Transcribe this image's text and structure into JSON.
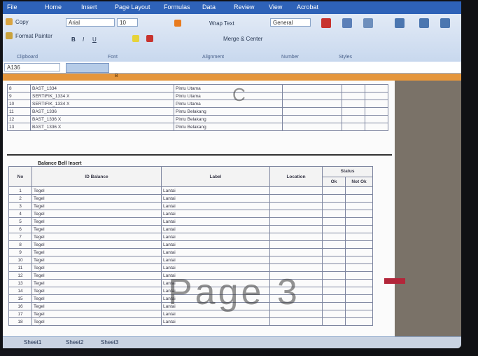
{
  "menu": {
    "tabs": [
      "File",
      "Home",
      "Insert",
      "Page Layout",
      "Formulas",
      "Data",
      "Review",
      "View",
      "Acrobat"
    ]
  },
  "ribbon": {
    "clipboard_copy": "Copy",
    "format_painter": "Format Painter",
    "clipboard_label": "Clipboard",
    "font_name": "Arial",
    "font_size": "10",
    "font_label": "Font",
    "wrap_text": "Wrap Text",
    "merge_center": "Merge & Center",
    "alignment_label": "Alignment",
    "number_format": "General",
    "number_label": "Number",
    "styles_label": "Styles"
  },
  "formula_bar": {
    "name_box": "A136"
  },
  "sheet": {
    "column_letter": "B",
    "top_rows": [
      {
        "num": "8",
        "name": "BAST_1334",
        "type": "Pintu Utama",
        "code": "",
        "a": "",
        "b": ""
      },
      {
        "num": "9",
        "name": "SERTIFIK_1334 X",
        "type": "Pintu Utama",
        "code": "",
        "a": "",
        "b": ""
      },
      {
        "num": "10",
        "name": "SERTIFIK_1334 X",
        "type": "Pintu Utama",
        "code": "",
        "a": "",
        "b": ""
      },
      {
        "num": "11",
        "name": "BAST_1336",
        "type": "Pintu Belakang",
        "code": "",
        "a": "",
        "b": ""
      },
      {
        "num": "12",
        "name": "BAST_1336 X",
        "type": "Pintu Belakang",
        "code": "",
        "a": "",
        "b": ""
      },
      {
        "num": "13",
        "name": "BAST_1336 X",
        "type": "Pintu Belakang",
        "code": "",
        "a": "",
        "b": ""
      }
    ],
    "section_title": "Balance Bell Insert",
    "headers": {
      "no": "No",
      "id": "ID Balance",
      "label": "Label",
      "location": "Location",
      "group": "Status",
      "sub1": "Ok",
      "sub2": "Not Ok"
    },
    "rows": [
      {
        "num": "1",
        "id": "Tegel",
        "label": "Lantai",
        "loc": ""
      },
      {
        "num": "2",
        "id": "Tegel",
        "label": "Lantai",
        "loc": ""
      },
      {
        "num": "3",
        "id": "Tegel",
        "label": "Lantai",
        "loc": ""
      },
      {
        "num": "4",
        "id": "Tegel",
        "label": "Lantai",
        "loc": ""
      },
      {
        "num": "5",
        "id": "Tegel",
        "label": "Lantai",
        "loc": ""
      },
      {
        "num": "6",
        "id": "Tegel",
        "label": "Lantai",
        "loc": ""
      },
      {
        "num": "7",
        "id": "Tegel",
        "label": "Lantai",
        "loc": ""
      },
      {
        "num": "8",
        "id": "Tegel",
        "label": "Lantai",
        "loc": ""
      },
      {
        "num": "9",
        "id": "Tegel",
        "label": "Lantai",
        "loc": ""
      },
      {
        "num": "10",
        "id": "Tegel",
        "label": "Lantai",
        "loc": ""
      },
      {
        "num": "11",
        "id": "Tegel",
        "label": "Lantai",
        "loc": ""
      },
      {
        "num": "12",
        "id": "Tegel",
        "label": "Lantai",
        "loc": ""
      },
      {
        "num": "13",
        "id": "Tegel",
        "label": "Lantai",
        "loc": ""
      },
      {
        "num": "14",
        "id": "Tegel",
        "label": "Lantai",
        "loc": ""
      },
      {
        "num": "15",
        "id": "Tegel",
        "label": "Lantai",
        "loc": ""
      },
      {
        "num": "16",
        "id": "Tegel",
        "label": "Lantai",
        "loc": ""
      },
      {
        "num": "17",
        "id": "Tegel",
        "label": "Lantai",
        "loc": ""
      },
      {
        "num": "18",
        "id": "Tegel",
        "label": "Lantai",
        "loc": ""
      }
    ],
    "page_watermark": "Page 3",
    "watermark_c": "C"
  },
  "tabs": {
    "sheet1": "Sheet1",
    "sheet2": "Sheet2",
    "sheet3": "Sheet3"
  },
  "colors": {
    "ribbon_blue": "#2e62b8",
    "column_header": "#e5963c"
  }
}
